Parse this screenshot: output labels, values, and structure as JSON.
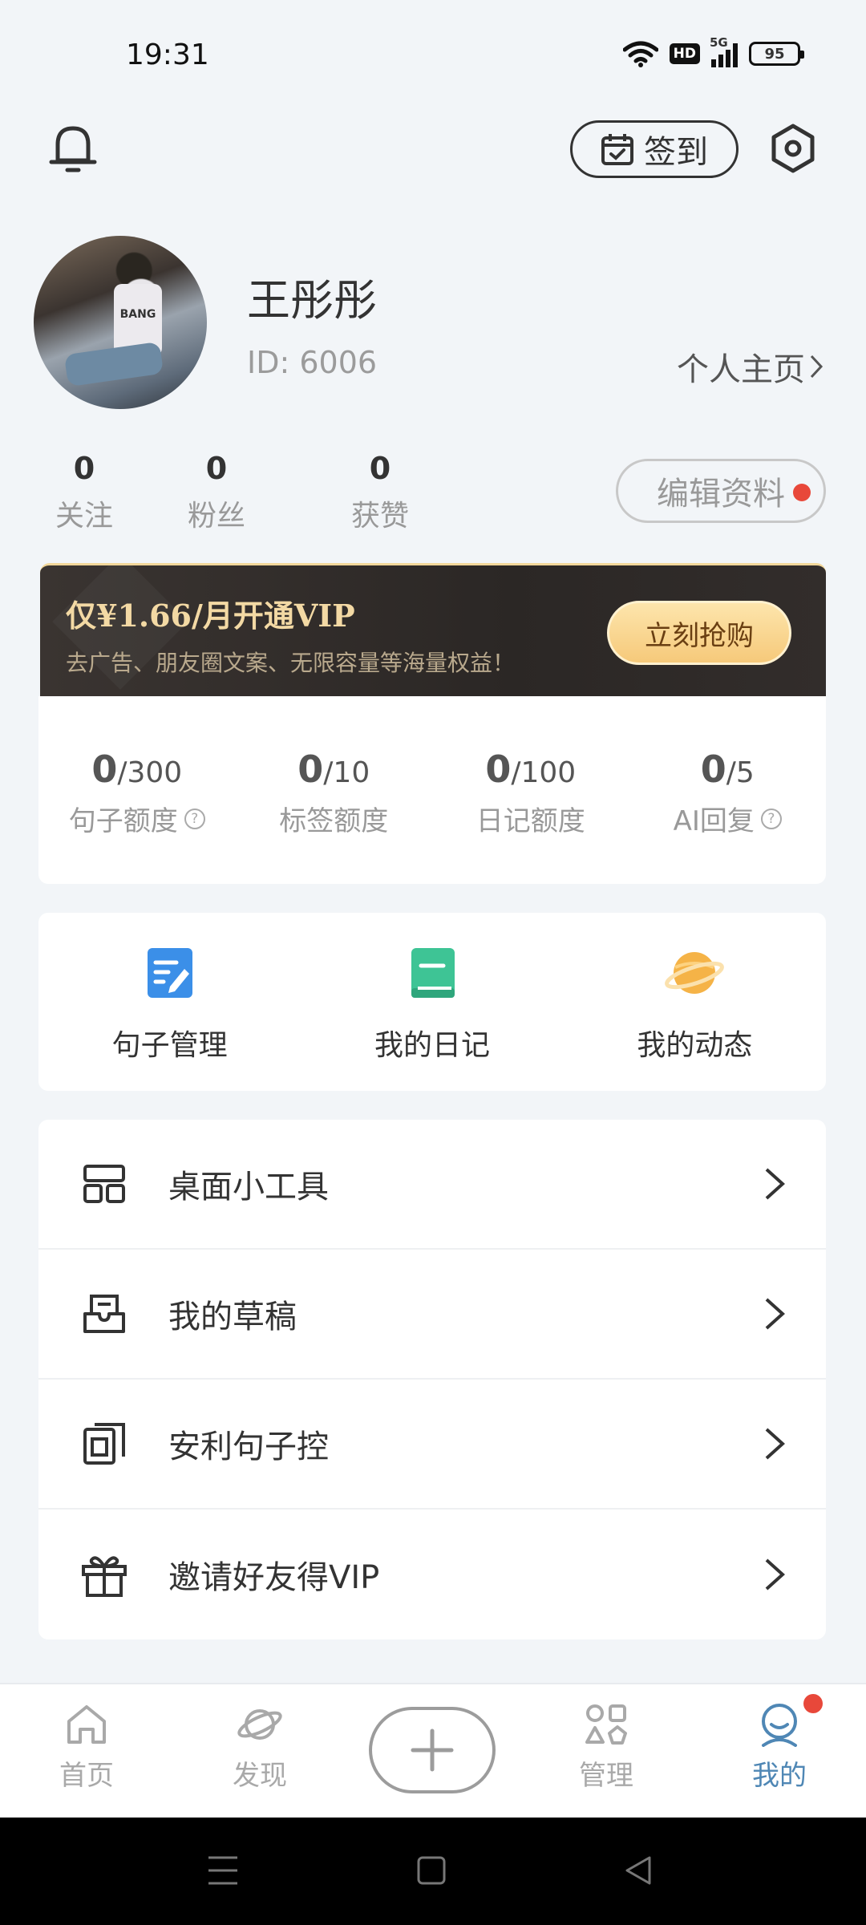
{
  "status_bar": {
    "time": "19:31",
    "hd": "HD",
    "network": "5G",
    "battery": "95"
  },
  "header": {
    "checkin_label": "签到"
  },
  "profile": {
    "name": "王彤彤",
    "id_text": "ID: 6006",
    "homepage_label": "个人主页",
    "avatar_shirt_text": "BANG"
  },
  "stats": [
    {
      "value": "0",
      "label": "关注"
    },
    {
      "value": "0",
      "label": "粉丝"
    },
    {
      "value": "0",
      "label": "获赞"
    }
  ],
  "edit_profile_label": "编辑资料",
  "vip": {
    "title": "仅¥1.66/月开通VIP",
    "subtitle": "去广告、朋友圈文案、无限容量等海量权益！",
    "button": "立刻抢购"
  },
  "quotas": [
    {
      "used": "0",
      "limit": "/300",
      "label": "句子额度",
      "help": true
    },
    {
      "used": "0",
      "limit": "/10",
      "label": "标签额度",
      "help": false
    },
    {
      "used": "0",
      "limit": "/100",
      "label": "日记额度",
      "help": false
    },
    {
      "used": "0",
      "limit": "/5",
      "label": "AI回复",
      "help": true
    }
  ],
  "help_glyph": "?",
  "shortcuts": [
    {
      "label": "句子管理",
      "icon": "edit-note-icon",
      "color": "#3b8fe8"
    },
    {
      "label": "我的日记",
      "icon": "diary-book-icon",
      "color": "#3ec495"
    },
    {
      "label": "我的动态",
      "icon": "planet-icon",
      "color": "#f2a93b"
    }
  ],
  "menu": [
    {
      "label": "桌面小工具",
      "icon": "widget-grid-icon"
    },
    {
      "label": "我的草稿",
      "icon": "draft-icon"
    },
    {
      "label": "安利句子控",
      "icon": "share-app-icon"
    },
    {
      "label": "邀请好友得VIP",
      "icon": "gift-icon"
    }
  ],
  "tabs": [
    {
      "label": "首页",
      "icon": "home-icon",
      "active": false
    },
    {
      "label": "发现",
      "icon": "discover-planet-icon",
      "active": false
    },
    {
      "label": "管理",
      "icon": "manage-shapes-icon",
      "active": false
    },
    {
      "label": "我的",
      "icon": "profile-icon",
      "active": true
    }
  ],
  "colors": {
    "accent": "#4f87b5",
    "badge": "#e8483a",
    "vip_gold": "#f3d9a4"
  }
}
